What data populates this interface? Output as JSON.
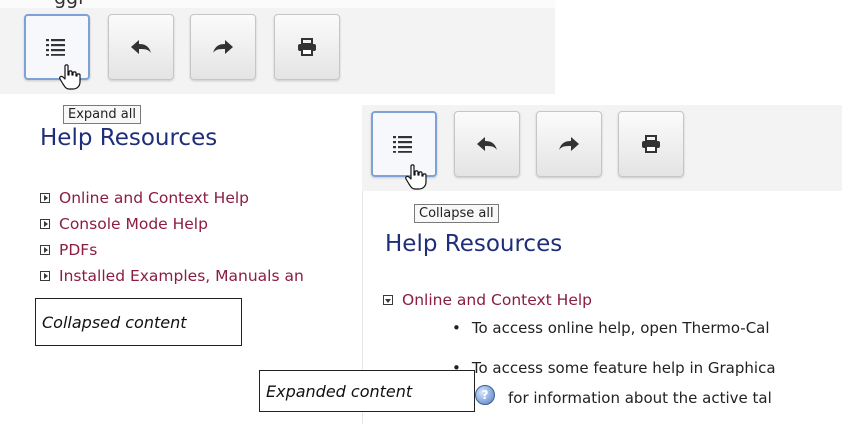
{
  "partial_top_text": "ggl",
  "collapsed_view": {
    "toolbar": {
      "buttons": [
        {
          "icon": "list-icon"
        },
        {
          "icon": "back-arrow-icon"
        },
        {
          "icon": "forward-arrow-icon"
        },
        {
          "icon": "print-icon"
        }
      ]
    },
    "tooltip": "Expand all",
    "heading": "Help Resources",
    "items": [
      "Online and Context Help",
      "Console Mode Help",
      "PDFs",
      "Installed Examples, Manuals an"
    ]
  },
  "collapsed_caption": "Collapsed content",
  "expanded_view": {
    "toolbar": {
      "buttons": [
        {
          "icon": "list-icon"
        },
        {
          "icon": "back-arrow-icon"
        },
        {
          "icon": "forward-arrow-icon"
        },
        {
          "icon": "print-icon"
        }
      ]
    },
    "tooltip": "Collapse all",
    "heading": "Help Resources",
    "expanded_item": "Online and Context Help",
    "bullets": [
      "To access online help, open Thermo-Cal",
      "To access some feature help in Graphica"
    ],
    "info_text": "for information about the active tal"
  },
  "expanded_caption": "Expanded content",
  "colors": {
    "heading": "#1f2e7a",
    "link": "#8b1d41",
    "active_button_border": "#7fa2d6"
  }
}
